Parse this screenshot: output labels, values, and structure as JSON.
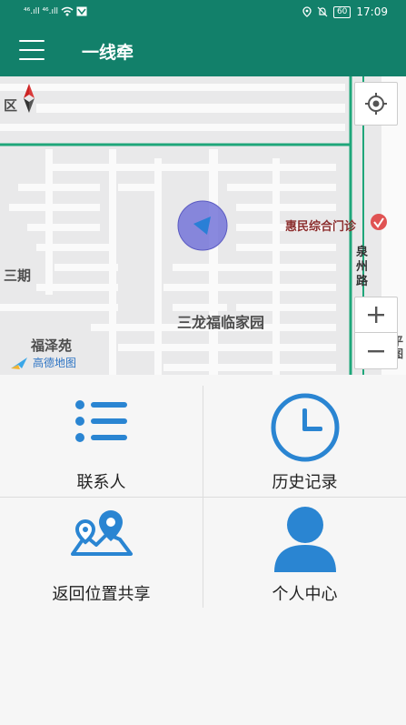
{
  "status_bar": {
    "signal_left": "⁴⁶.ıll ⁴⁶.ıll",
    "time": "17:09",
    "battery": "60"
  },
  "app_bar": {
    "title": "一线牵"
  },
  "map": {
    "labels": {
      "district_partial": "区",
      "clinic": "惠民综合门诊",
      "phase3": "三期",
      "road": "泉州路",
      "residence": "三龙福临家园",
      "fuze": "福泽苑",
      "edge_partial": "平",
      "edge_partial2": "图"
    },
    "provider": "高德地图"
  },
  "menu": {
    "contacts": "联系人",
    "history": "历史记录",
    "share": "返回位置共享",
    "profile": "个人中心"
  },
  "colors": {
    "primary": "#12806a",
    "icon_blue": "#2a85d2"
  }
}
